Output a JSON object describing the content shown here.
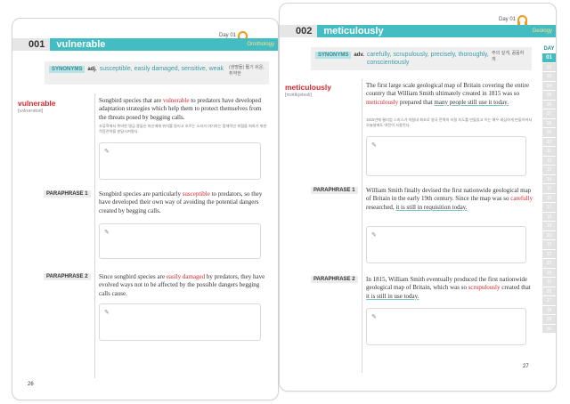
{
  "left": {
    "day": "Day 01",
    "number": "001",
    "word": "vulnerable",
    "subject": "Ornithology",
    "synonyms": {
      "tag": "SYNONYMS",
      "pos": "adj.",
      "words": "susceptible, easily damaged, sensitive, weak",
      "korean": "(생명들) 뚫기 쉬운, 취약한"
    },
    "headword": "vulnerable",
    "ipa": "[vʌlnərəbəl]",
    "sentence": {
      "pre": "Songbird species that are ",
      "hl": "vulnerable",
      "post": " to predators have developed adaptation strategies which help them to protect themselves from the threats posed by begging calls."
    },
    "korean": "조류학에서 취약한 명금 종들은 자신에게 위치를 알리고 조르는 소리가 야기하는 잠재적인 위협을 피하기 위한 적응전략을 발달시켜왔다.",
    "paraphrase1": {
      "label": "PARAPHRASE 1",
      "pre": "Songbird species are particularly ",
      "hl": "susceptible",
      "post": " to predators, so they have developed their own way of avoiding the potential dangers created by begging calls."
    },
    "paraphrase2": {
      "label": "PARAPHRASE 2",
      "pre": "Since songbird species are ",
      "hl": "easily damaged",
      "post": " by predators, they have evolved ways not to be affected by the possible dangers begging calls cause."
    },
    "page_number": "26"
  },
  "right": {
    "day": "Day 01",
    "number": "002",
    "word": "meticulously",
    "subject": "Geology",
    "synonyms": {
      "tag": "SYNONYMS",
      "pos": "adv.",
      "words": "carefully, scrupulously, precisely, thoroughly, conscientiously",
      "korean": "주의 깊게, 꼼꼼하게"
    },
    "headword": "meticulously",
    "ipa": "[mətikjələsli]",
    "sentence": {
      "pre": "The first large scale geological map of Britain covering the entire country that William Smith ultimately created in 1815 was so ",
      "hl": "meticulously",
      "mid": " prepared that ",
      "ul": "many people still use it today."
    },
    "korean": "1815년에 윌리엄 스미스가 마침내 최초로 영국 전역의 지질 지도를 만들었고 이는 매우 세심하게 만들어져서 오늘날에도 여전히 사용된다.",
    "paraphrase1": {
      "label": "PARAPHRASE 1",
      "pre": "William Smith finally devised the first nationwide geological map of Britain in the early 19th century. Since the map was so ",
      "hl": "carefully",
      "mid": " researched, ",
      "ul": "it is still in requisition today."
    },
    "paraphrase2": {
      "label": "PARAPHRASE 2",
      "pre": "In 1815, William Smith eventually produced the first nationwide geological map of Britain, which was so ",
      "hl": "scrupulously",
      "mid": " created that ",
      "ul": "it is still in use today."
    },
    "page_number": "27",
    "day_tabs": {
      "label": "DAY",
      "items": [
        "01",
        "02",
        "03",
        "04",
        "05",
        "06",
        "07",
        "08",
        "09",
        "10",
        "11",
        "12",
        "13",
        "14",
        "15",
        "16",
        "17",
        "18",
        "19",
        "20",
        "21",
        "22",
        "23",
        "24",
        "25",
        "26",
        "27",
        "28",
        "29",
        "30"
      ],
      "active": "01"
    }
  },
  "colors": {
    "accent": "#43bcc2",
    "highlight": "#d8262e",
    "headphone": "#f39a1d"
  },
  "icons": {
    "day": "headphones-icon",
    "memo": "pencil-icon"
  }
}
